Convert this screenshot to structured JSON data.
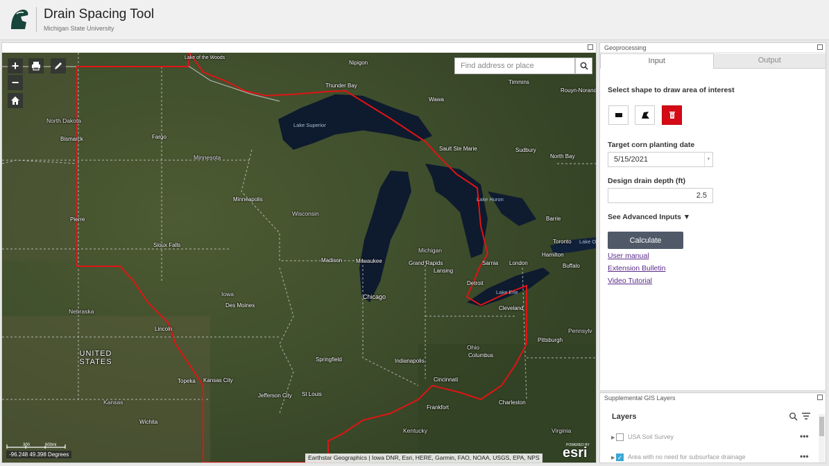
{
  "header": {
    "title": "Drain Spacing Tool",
    "subtitle": "Michigan State University",
    "logo_icon": "spartan-helmet-icon"
  },
  "map": {
    "search_placeholder": "Find address or place",
    "zoom_in": "+",
    "zoom_out": "−",
    "coordinates": "-96.248 49.398 Degrees",
    "scale_labels": [
      "0",
      "300",
      "600mi"
    ],
    "attribution": "Earthstar Geographics | Iowa DNR, Esri, HERE, Garmin, FAO, NOAA, USGS, EPA, NPS",
    "esri_powered": "POWERED BY",
    "esri_logo": "esri",
    "labels": {
      "lake_woods": "Lake of the Woods",
      "nipigon": "Nipigon",
      "thunder_bay": "Thunder Bay",
      "timmins": "Timmins",
      "rouyn": "Rouyn-Noranda",
      "wawa": "Wawa",
      "north_dakota": "North Dakota",
      "fargo": "Fargo",
      "bismarck": "Bismarck",
      "lake_superior": "Lake Superior",
      "minnesota": "Minnesota",
      "sault": "Sault Ste Marie",
      "sudbury": "Sudbury",
      "north_bay": "North Bay",
      "minneapolis": "Minneapolis",
      "wisconsin": "Wisconsin",
      "lake_huron": "Lake Huron",
      "barrie": "Barrie",
      "pierre": "Pierre",
      "sioux_falls": "Sioux Falls",
      "michigan": "Michigan",
      "toronto": "Toronto",
      "lake_ontario": "Lake Ontario",
      "madison": "Madison",
      "milwaukee": "Milwaukee",
      "grand_rapids": "Grand Rapids",
      "lansing": "Lansing",
      "sarnia": "Sarnia",
      "london": "London",
      "hamilton": "Hamilton",
      "buffalo": "Buffalo",
      "detroit": "Detroit",
      "lake_erie": "Lake Erie",
      "iowa": "Iowa",
      "des_moines": "Des Moines",
      "chicago": "Chicago",
      "cleveland": "Cleveland",
      "nebraska": "Nebraska",
      "lincoln": "Lincoln",
      "pennsylvania": "Pennsylv",
      "pittsburgh": "Pittsburgh",
      "ohio": "Ohio",
      "columbus": "Columbus",
      "united_states": "UNITED STATES",
      "springfield": "Springfield",
      "indianapolis": "Indianapolis",
      "topeka": "Topeka",
      "kansas_city": "Kansas City",
      "cincinnati": "Cincinnati",
      "jefferson_city": "Jefferson City",
      "st_louis": "St Louis",
      "charleston": "Charleston",
      "kansas": "Kansas",
      "frankfort": "Frankfort",
      "wichita": "Wichita",
      "kentucky": "Kentucky",
      "virginia": "Virginia"
    }
  },
  "geoprocessing": {
    "panel_title": "Geoprocessing",
    "tabs": [
      "Input",
      "Output"
    ],
    "select_shape_label": "Select shape to draw area of interest",
    "planting_date_label": "Target corn planting date",
    "planting_date_value": "5/15/2021",
    "drain_depth_label": "Design drain depth (ft)",
    "drain_depth_value": "2.5",
    "advanced_label": "See Advanced Inputs ▼",
    "calculate_label": "Calculate",
    "links": [
      "User manual",
      "Extension Bulletin",
      "Video Tutorial"
    ],
    "delete_color": "#d50a17"
  },
  "layers_panel": {
    "panel_title": "Supplemental GIS Layers",
    "heading": "Layers",
    "layers": [
      {
        "label": "USA Soil Survey",
        "checked": false
      },
      {
        "label": "Area with no need for subsurface drainage",
        "checked": true
      }
    ]
  }
}
